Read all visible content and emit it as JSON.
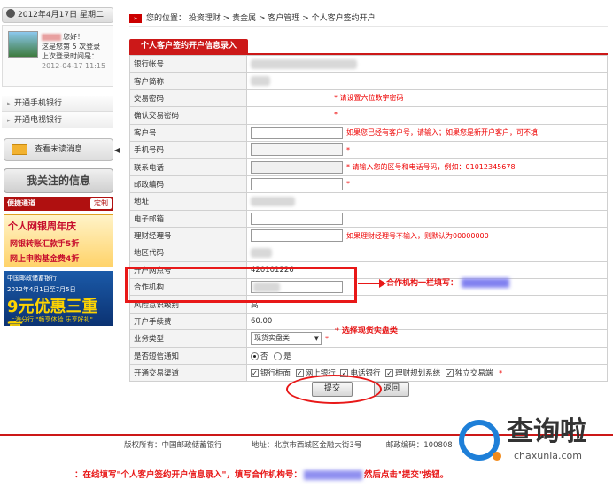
{
  "sidebar": {
    "date": "2012年4月17日 星期二",
    "user": {
      "greeting": "您好！",
      "login_count": "这是您第 5 次登录",
      "last_login_label": "上次登录时间是：",
      "last_login_time": "2012-04-17 11:15"
    },
    "nav_items": [
      {
        "label": "开通手机银行"
      },
      {
        "label": "开通电视银行"
      }
    ],
    "messages_button": "查看未读消息",
    "focus_info": "我关注的信息",
    "quick_channel": "便捷通道",
    "customize": "定制",
    "banner1": {
      "line1": "个人网银周年庆",
      "line2": "网银转账汇款手5折",
      "line3": "网上申购基金费4折"
    },
    "banner2": {
      "line1": "中国邮政储蓄银行",
      "line2": "2012年4月1日至7月5日",
      "line3": "9元优惠三重享",
      "line4": "上海分行 \"畅享体验 乐享好礼\""
    }
  },
  "breadcrumb": {
    "icon": "»",
    "text": "您的位置： 投资理财 > 贵金属 > 客户管理 > 个人客户签约开户"
  },
  "form": {
    "title": "个人客户签约开户信息录入",
    "rows": {
      "bank_account": "银行帐号",
      "customer_name": "客户简称",
      "trade_password": "交易密码",
      "trade_password_hint": "* 请设置六位数字密码",
      "confirm_password": "确认交易密码",
      "confirm_password_req": "*",
      "customer_no": "客户号",
      "customer_no_hint": "如果您已经有客户号，请输入；如果您是新开户客户，可不填",
      "mobile": "手机号码",
      "mobile_req": "*",
      "phone": "联系电话",
      "phone_hint": "* 请输入您的区号和电话号码，例如：01012345678",
      "postcode": "邮政编码",
      "postcode_req": "*",
      "address": "地址",
      "email": "电子邮箱",
      "manager_no": "理财经理号",
      "manager_no_hint": "如果理财经理号不输入，则默认为00000000",
      "region_code": "地区代码",
      "branch_no": "开户网点号",
      "branch_no_value": "420101226",
      "partner": "合作机构",
      "risk_level": "风险意识级别",
      "risk_level_value": "高",
      "fee": "开户手续费",
      "fee_value": "60.00",
      "business_type": "业务类型",
      "business_type_value": "现货实盘类",
      "business_type_req": "*",
      "sms": "是否短信通知",
      "sms_no": "否",
      "sms_yes": "是",
      "channels": "开通交易渠道",
      "channels_req": "*"
    },
    "channels_list": [
      "银行柜面",
      "网上银行",
      "电话银行",
      "理财规划系统",
      "独立交易端"
    ],
    "submit": "提交",
    "back": "返回"
  },
  "annotations": {
    "partner_note": "合作机构一栏填写：",
    "business_note": "选择现货实盘类",
    "bottom_note_a": "：在线填写\"个人客户签约开户信息录入\"，填写合作机构号：",
    "bottom_note_b": "然后点击\"提交\"按钮。"
  },
  "footer": {
    "copyright": "版权所有：中国邮政储蓄银行",
    "address": "地址：北京市西城区金融大街3号",
    "postcode": "邮政编码：100808"
  },
  "watermark": {
    "brand": "查询啦",
    "url": "chaxunla.com"
  }
}
